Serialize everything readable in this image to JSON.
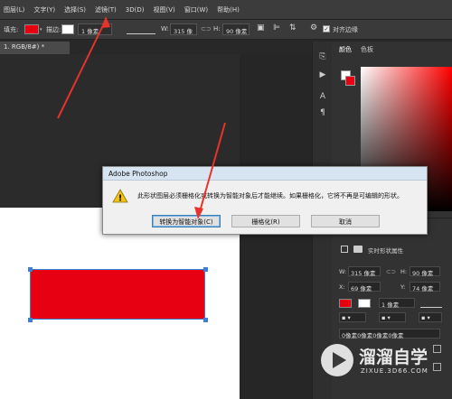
{
  "menubar": {
    "items": [
      "图层(L)",
      "文字(Y)",
      "选择(S)",
      "滤镜(T)",
      "3D(D)",
      "视图(V)",
      "窗口(W)",
      "帮助(H)"
    ]
  },
  "options": {
    "fill_label": "填充:",
    "stroke_label": "描边:",
    "stroke_width": "1 像素",
    "w_label": "W:",
    "w_value": "315 像",
    "h_label": "H:",
    "h_value": "90 像素",
    "align_edges": "对齐边缘"
  },
  "document_tab": "1. RGB/8#) *",
  "panels": {
    "color_tab": "颜色",
    "swatches_tab": "色板",
    "properties_title": "实时形状属性",
    "w_label": "W:",
    "w_value": "315 像素",
    "h_label": "H:",
    "h_value": "90 像素",
    "x_label": "X:",
    "x_value": "69 像素",
    "y_label": "Y:",
    "y_value": "74 像素",
    "stroke_px": "1 像素",
    "corner_text": "0像素0像素0像素0像素"
  },
  "dialog": {
    "title": "Adobe Photoshop",
    "message": "此形状图层必须栅格化或转换为智能对象后才能继续。如果栅格化，它将不再是可编辑的形状。",
    "convert_button": "转换为智能对象(C)",
    "rasterize_button": "栅格化(R)",
    "cancel_button": "取消"
  },
  "watermark": {
    "brand": "溜溜自学",
    "url": "ZIXUE.3D66.COM"
  },
  "colors": {
    "accent_red": "#e60012",
    "arrow_red": "#e8322b",
    "selection_blue": "#3d7fd8"
  }
}
